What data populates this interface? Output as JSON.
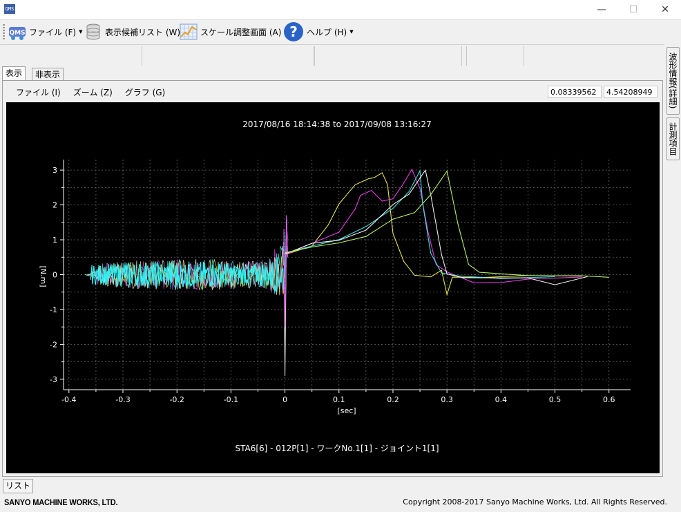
{
  "window": {
    "icon_text": "QMS",
    "minimize_glyph": "—",
    "maximize_glyph": "☐",
    "close_glyph": "✕"
  },
  "toolbar": {
    "items": [
      {
        "label": "ファイル (F)",
        "icon": "qms-logo-icon",
        "has_dropdown": true
      },
      {
        "label": "表示候補リスト (W)",
        "icon": "database-icon",
        "has_dropdown": false
      },
      {
        "label": "スケール調整画面 (A)",
        "icon": "chart-scale-icon",
        "has_dropdown": false
      },
      {
        "label": "ヘルプ (H)",
        "icon": "help-icon",
        "has_dropdown": true
      }
    ]
  },
  "tabs": [
    {
      "label": "表示",
      "active": true
    },
    {
      "label": "非表示",
      "active": false
    }
  ],
  "panel_menu": [
    "ファイル (I)",
    "ズーム (Z)",
    "グラフ (G)"
  ],
  "coordinates": {
    "x": "0.08339562",
    "y": "4.54208949"
  },
  "side_tabs": [
    "波形情報(詳細)",
    "計測項目"
  ],
  "list_button": "リスト",
  "footer": {
    "logo": "SANYO MACHINE WORKS, LTD.",
    "copyright": "Copyright 2008-2017 Sanyo Machine Works, Ltd. All Rights Reserved."
  },
  "chart_data": {
    "type": "line",
    "title": "2017/08/16 18:14:38 to 2017/09/08 13:16:27",
    "subtitle": "STA6[6] - 012P[1] - ワークNo.1[1] - ジョイント1[1]",
    "xlabel": "[sec]",
    "ylabel": "[N.m]",
    "xlim": [
      -0.41,
      0.64
    ],
    "ylim": [
      -3.3,
      3.3
    ],
    "x_ticks": [
      "-0.4",
      "-0.3",
      "-0.2",
      "-0.1",
      "0",
      "0.1",
      "0.2",
      "0.3",
      "0.4",
      "0.5",
      "0.6"
    ],
    "y_ticks": [
      "-3",
      "-2",
      "-1",
      "0",
      "1",
      "2",
      "3"
    ],
    "grid": true,
    "background": "#000000",
    "series": [
      {
        "color": "#e6e64a",
        "points": [
          [
            0.0,
            0.6
          ],
          [
            0.05,
            0.85
          ],
          [
            0.08,
            1.4
          ],
          [
            0.1,
            2.0
          ],
          [
            0.13,
            2.6
          ],
          [
            0.155,
            2.75
          ],
          [
            0.165,
            2.8
          ],
          [
            0.18,
            2.95
          ],
          [
            0.19,
            2.6
          ],
          [
            0.2,
            1.2
          ],
          [
            0.22,
            0.4
          ],
          [
            0.24,
            0.0
          ],
          [
            0.27,
            -0.05
          ],
          [
            0.29,
            0.1
          ],
          [
            0.3,
            -0.6
          ],
          [
            0.31,
            -0.1
          ],
          [
            0.36,
            -0.1
          ],
          [
            0.45,
            -0.05
          ],
          [
            0.55,
            -0.05
          ]
        ]
      },
      {
        "color": "#e040e0",
        "points": [
          [
            0.0,
            0.6
          ],
          [
            0.05,
            0.9
          ],
          [
            0.1,
            1.2
          ],
          [
            0.13,
            1.9
          ],
          [
            0.14,
            2.3
          ],
          [
            0.16,
            2.4
          ],
          [
            0.18,
            2.1
          ],
          [
            0.2,
            2.2
          ],
          [
            0.22,
            2.6
          ],
          [
            0.235,
            3.0
          ],
          [
            0.25,
            2.5
          ],
          [
            0.265,
            1.2
          ],
          [
            0.28,
            0.3
          ],
          [
            0.3,
            0.1
          ],
          [
            0.35,
            -0.25
          ],
          [
            0.4,
            -0.2
          ],
          [
            0.45,
            -0.1
          ],
          [
            0.55,
            -0.05
          ]
        ]
      },
      {
        "color": "#40e0e0",
        "points": [
          [
            0.0,
            0.6
          ],
          [
            0.05,
            0.85
          ],
          [
            0.1,
            1.0
          ],
          [
            0.15,
            1.4
          ],
          [
            0.2,
            1.9
          ],
          [
            0.23,
            2.4
          ],
          [
            0.25,
            3.0
          ],
          [
            0.255,
            2.0
          ],
          [
            0.27,
            0.6
          ],
          [
            0.29,
            0.05
          ],
          [
            0.32,
            -0.05
          ],
          [
            0.4,
            -0.1
          ],
          [
            0.5,
            -0.05
          ]
        ]
      },
      {
        "color": "#f0f0f0",
        "points": [
          [
            0.0,
            0.6
          ],
          [
            0.05,
            0.9
          ],
          [
            0.1,
            1.0
          ],
          [
            0.15,
            1.3
          ],
          [
            0.2,
            2.0
          ],
          [
            0.23,
            2.3
          ],
          [
            0.26,
            3.0
          ],
          [
            0.27,
            2.3
          ],
          [
            0.29,
            0.6
          ],
          [
            0.3,
            0.0
          ],
          [
            0.33,
            -0.1
          ],
          [
            0.45,
            -0.1
          ],
          [
            0.5,
            -0.3
          ],
          [
            0.56,
            -0.05
          ]
        ]
      },
      {
        "color": "#b8f060",
        "points": [
          [
            0.0,
            0.6
          ],
          [
            0.05,
            0.8
          ],
          [
            0.1,
            0.9
          ],
          [
            0.15,
            1.1
          ],
          [
            0.2,
            1.6
          ],
          [
            0.24,
            1.8
          ],
          [
            0.27,
            2.3
          ],
          [
            0.3,
            3.0
          ],
          [
            0.32,
            1.5
          ],
          [
            0.34,
            0.3
          ],
          [
            0.36,
            0.05
          ],
          [
            0.45,
            -0.05
          ],
          [
            0.55,
            -0.05
          ],
          [
            0.6,
            -0.05
          ]
        ]
      }
    ]
  }
}
